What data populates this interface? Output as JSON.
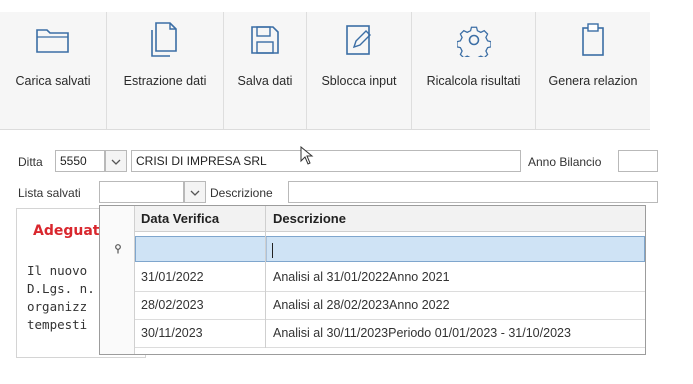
{
  "toolbar": {
    "buttons": [
      {
        "label": "Carica salvati",
        "icon": "folder-icon"
      },
      {
        "label": "Estrazione dati",
        "icon": "copy-documents-icon"
      },
      {
        "label": "Salva dati",
        "icon": "floppy-disk-icon"
      },
      {
        "label": "Sblocca input",
        "icon": "edit-document-icon"
      },
      {
        "label": "Ricalcola risultati",
        "icon": "gear-icon"
      },
      {
        "label": "Genera relazion",
        "icon": "clipboard-icon"
      }
    ]
  },
  "form": {
    "ditta_label": "Ditta",
    "ditta_code": "5550",
    "ditta_name": "CRISI DI IMPRESA SRL",
    "anno_bilancio_label": "Anno Bilancio",
    "lista_salvati_label": "Lista salvati",
    "descrizione_label": "Descrizione"
  },
  "background_panel": {
    "heading": "Adeguat",
    "lines": [
      "Il nuovo",
      "D.Lgs. n.",
      "organizz",
      "tempesti"
    ]
  },
  "dropdown_grid": {
    "columns": [
      "Data Verifica",
      "Descrizione"
    ],
    "rows": [
      {
        "date": "31/01/2022",
        "description": "Analisi al 31/01/2022Anno 2021"
      },
      {
        "date": "28/02/2023",
        "description": "Analisi al 28/02/2023Anno 2022"
      },
      {
        "date": "30/11/2023",
        "description": "Analisi al 30/11/2023Periodo 01/01/2023 - 31/10/2023"
      }
    ]
  },
  "colors": {
    "accent_blue": "#3b6ea5",
    "heading_red": "#d9272e",
    "filter_row": "#cfe3f5"
  }
}
